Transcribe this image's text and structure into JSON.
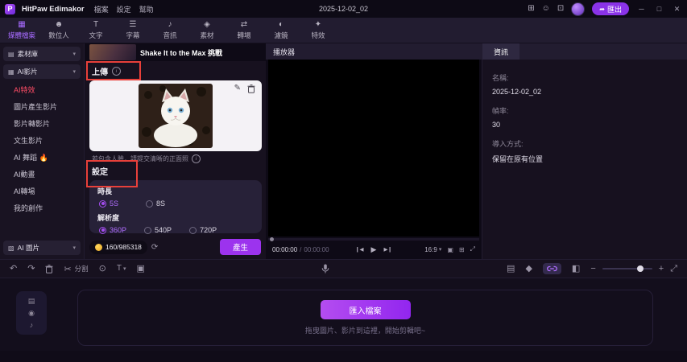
{
  "titlebar": {
    "logo_letter": "P",
    "app_name": "HitPaw Edimakor",
    "menus": [
      "檔案",
      "設定",
      "幫助"
    ],
    "document_title": "2025-12-02_02",
    "export_label": "匯出"
  },
  "ribbon": {
    "tabs": [
      {
        "label": "媒體檔案",
        "icon": "▦",
        "active": true
      },
      {
        "label": "數位人",
        "icon": "☻",
        "active": false
      },
      {
        "label": "文字",
        "icon": "T",
        "active": false
      },
      {
        "label": "字幕",
        "icon": "☰",
        "active": false
      },
      {
        "label": "音訊",
        "icon": "♪",
        "active": false
      },
      {
        "label": "素材",
        "icon": "◈",
        "active": false
      },
      {
        "label": "轉場",
        "icon": "⇄",
        "active": false
      },
      {
        "label": "濾鏡",
        "icon": "◐",
        "active": false
      },
      {
        "label": "特效",
        "icon": "✦",
        "active": false
      }
    ]
  },
  "sidebar": {
    "library_label": "素材庫",
    "ai_video_label": "AI影片",
    "items": [
      "AI特效",
      "圖片產生影片",
      "影片轉影片",
      "文生影片",
      "AI 舞蹈 🔥",
      "AI動畫",
      "AI轉場",
      "我的創作"
    ],
    "active_item": "AI特效",
    "ai_image_label": "AI 圖片"
  },
  "generator_panel": {
    "featured_caption": "Shake It to the Max 挑戰",
    "upload_section": "上傳",
    "face_note": "若包含人臉，請提交清晰的正面照",
    "settings_section": "設定",
    "duration_label": "時長",
    "duration_options": [
      "5S",
      "8S"
    ],
    "duration_selected": "5S",
    "resolution_label": "解析度",
    "resolution_options": [
      "360P",
      "540P",
      "720P"
    ],
    "resolution_selected": "360P",
    "credits": "160/985318",
    "generate_label": "產生"
  },
  "player": {
    "title": "播放器",
    "current_time": "00:00:00",
    "time_separator": "/",
    "total_time": "00:00:00",
    "aspect_ratio": "16:9"
  },
  "info_panel": {
    "tab": "資訊",
    "fields": [
      {
        "label": "名稱:",
        "value": "2025-12-02_02"
      },
      {
        "label": "幀率:",
        "value": "30"
      },
      {
        "label": "導入方式:",
        "value": "保留在原有位置"
      }
    ]
  },
  "timeline": {
    "split_label": "分割",
    "import_button": "匯入檔案",
    "drop_hint": "拖曳圖片、影片到這裡，開始剪輯吧~"
  },
  "colors": {
    "accent_purple": "#9c33ee",
    "annotation_red": "#e8403a",
    "active_item_red": "#ff4d66"
  },
  "icons": {
    "apps": "⊞",
    "smiley": "☺",
    "widget": "⊡",
    "export_arrow": "➦",
    "minimize": "─",
    "maximize": "□",
    "close": "✕",
    "caret_down": "▾",
    "library": "▤",
    "ai_video": "▦",
    "ai_image": "▧",
    "info": "i",
    "edit": "✎",
    "refresh": "⟳",
    "undo": "↶",
    "redo": "↷",
    "scissors": "✂",
    "badge": "⊙",
    "text_tool": "T",
    "crop": "▣",
    "prev": "❙◀",
    "play": "▶",
    "next": "▶❙",
    "snapshot": "▣",
    "grid_view": "⊞",
    "fullscreen": "⤢",
    "tracks": "▤",
    "keyframe": "◆",
    "preview": "◧",
    "zoom_out": "−",
    "zoom_in": "+",
    "fit": "⤢",
    "film": "▤",
    "eye": "◉",
    "speaker": "♪"
  }
}
